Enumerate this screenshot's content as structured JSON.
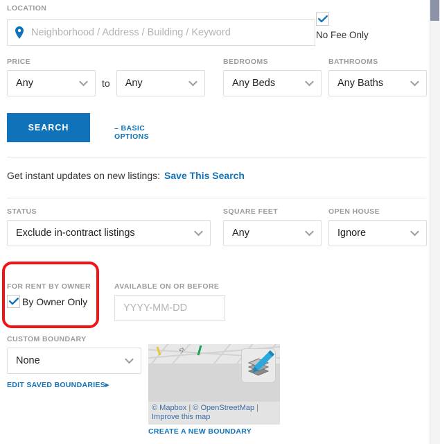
{
  "colors": {
    "accent": "#1072b8",
    "highlight": "#f01414",
    "label": "#9b9b9b",
    "placeholder": "#b4b4b4",
    "map_link": "#3b6ea5"
  },
  "location": {
    "label": "LOCATION",
    "placeholder": "Neighborhood / Address / Building / Keyword",
    "value": "",
    "icon": "map-pin-icon"
  },
  "no_fee": {
    "label": "No Fee Only",
    "checked": true
  },
  "price": {
    "label": "PRICE",
    "min_value": "Any",
    "max_value": "Any",
    "connector": "to"
  },
  "bedrooms": {
    "label": "BEDROOMS",
    "value": "Any Beds"
  },
  "bathrooms": {
    "label": "BATHROOMS",
    "value": "Any Baths"
  },
  "actions": {
    "search_label": "SEARCH",
    "basic_options_label": "– BASIC OPTIONS"
  },
  "save_search": {
    "text": "Get instant updates on new listings:",
    "link_label": "Save This Search"
  },
  "status": {
    "label": "STATUS",
    "value": "Exclude in-contract listings"
  },
  "square_feet": {
    "label": "SQUARE FEET",
    "value": "Any"
  },
  "open_house": {
    "label": "OPEN HOUSE",
    "value": "Ignore"
  },
  "for_rent_by_owner": {
    "label": "FOR RENT BY OWNER",
    "checkbox_label": "By Owner Only",
    "checked": true,
    "highlighted": true
  },
  "available_on_or_before": {
    "label": "AVAILABLE ON OR BEFORE",
    "placeholder": "YYYY-MM-DD",
    "value": ""
  },
  "custom_boundary": {
    "label": "CUSTOM BOUNDARY",
    "value": "None",
    "edit_link_label": "EDIT SAVED BOUNDARIES",
    "create_link_label": "CREATE A NEW BOUNDARY"
  },
  "map": {
    "attrib_mapbox": "© Mapbox",
    "attrib_osm": "© OpenStreetMap",
    "attrib_improve": "Improve this map",
    "separator": "|",
    "layers_icon": "layers-pencil-icon"
  }
}
